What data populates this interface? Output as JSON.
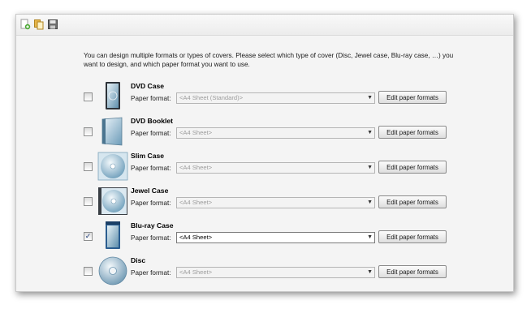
{
  "toolbar": {
    "icons": [
      "new-document-icon",
      "copy-document-icon",
      "save-icon"
    ]
  },
  "intro": "You can design multiple formats or types of covers. Please select which type of cover (Disc, Jewel case, Blu-ray case, …) you want to design, and which paper format you want to use.",
  "paper_format_label": "Paper format:",
  "edit_button_label": "Edit paper formats",
  "covers": [
    {
      "title": "DVD Case",
      "checked": false,
      "format": "<A4 Sheet (Standard)>",
      "icon": "dvd-case-icon"
    },
    {
      "title": "DVD Booklet",
      "checked": false,
      "format": "<A4 Sheet>",
      "icon": "dvd-booklet-icon"
    },
    {
      "title": "Slim Case",
      "checked": false,
      "format": "<A4 Sheet>",
      "icon": "slim-case-icon"
    },
    {
      "title": "Jewel Case",
      "checked": false,
      "format": "<A4 Sheet>",
      "icon": "jewel-case-icon"
    },
    {
      "title": "Blu-ray Case",
      "checked": true,
      "format": "<A4 Sheet>",
      "icon": "blu-ray-case-icon"
    },
    {
      "title": "Disc",
      "checked": false,
      "format": "<A4 Sheet>",
      "icon": "disc-icon"
    }
  ],
  "colors": {
    "accent": "#1c3b7a",
    "panel": "#f4f4f4"
  }
}
